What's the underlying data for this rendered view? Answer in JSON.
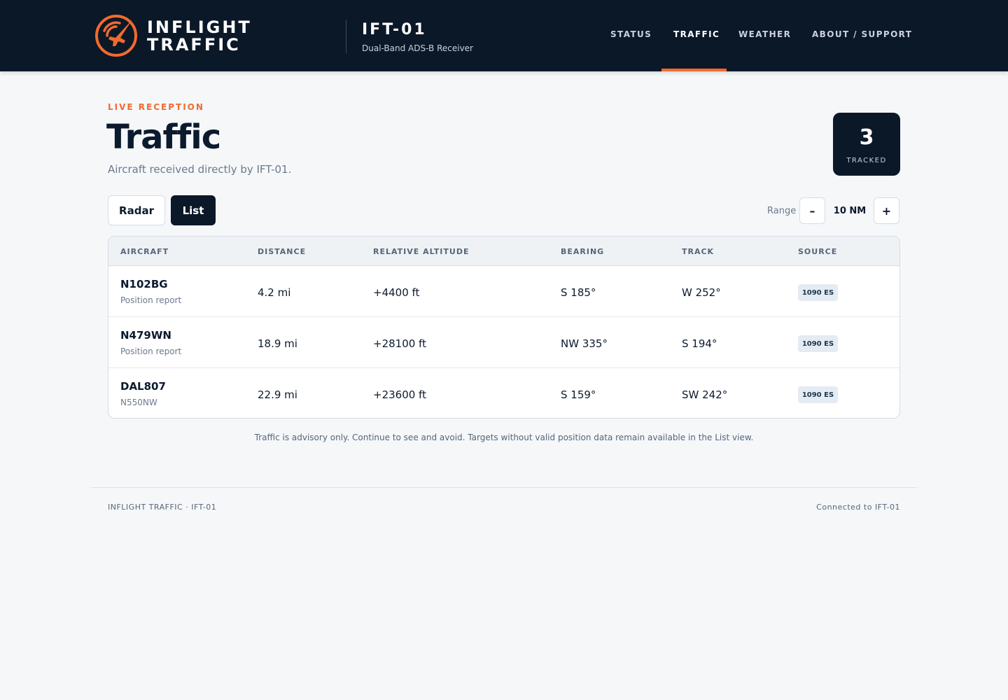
{
  "brand": {
    "line1": "INFLIGHT",
    "line2": "TRAFFIC",
    "accent_color": "#f26a2e",
    "logo_icon": "compass-plane-logo-icon"
  },
  "device": {
    "id": "IFT-01",
    "subtitle": "Dual-Band ADS-B Receiver"
  },
  "nav": {
    "items": [
      {
        "label": "STATUS"
      },
      {
        "label": "TRAFFIC",
        "active": true
      },
      {
        "label": "WEATHER"
      },
      {
        "label": "ABOUT / SUPPORT"
      }
    ]
  },
  "page": {
    "kicker": "LIVE RECEPTION",
    "title": "Traffic",
    "subtitle": "Aircraft received directly by IFT-01."
  },
  "tracked": {
    "count": "3",
    "label": "TRACKED"
  },
  "view": {
    "radar_label": "Radar",
    "list_label": "List",
    "selected": "List"
  },
  "range": {
    "label": "Range",
    "minus": "–",
    "value": "10 NM",
    "plus": "+"
  },
  "table": {
    "headers": [
      "AIRCRAFT",
      "DISTANCE",
      "RELATIVE ALTITUDE",
      "BEARING",
      "TRACK",
      "SOURCE"
    ],
    "rows": [
      {
        "aircraft": "N102BG",
        "detail": "Position report",
        "distance": "4.2 mi",
        "altitude": "+4400 ft",
        "bearing": "S 185°",
        "track": "W 252°",
        "source": "1090 ES"
      },
      {
        "aircraft": "N479WN",
        "detail": "Position report",
        "distance": "18.9 mi",
        "altitude": "+28100 ft",
        "bearing": "NW 335°",
        "track": "S 194°",
        "source": "1090 ES"
      },
      {
        "aircraft": "DAL807",
        "detail": "N550NW",
        "distance": "22.9 mi",
        "altitude": "+23600 ft",
        "bearing": "S 159°",
        "track": "SW 242°",
        "source": "1090 ES"
      }
    ]
  },
  "advisory": "Traffic is advisory only. Continue to see and avoid. Targets without valid position data remain available in the List view.",
  "footer": {
    "left": "INFLIGHT TRAFFIC · IFT-01",
    "right": "Connected to IFT-01"
  }
}
